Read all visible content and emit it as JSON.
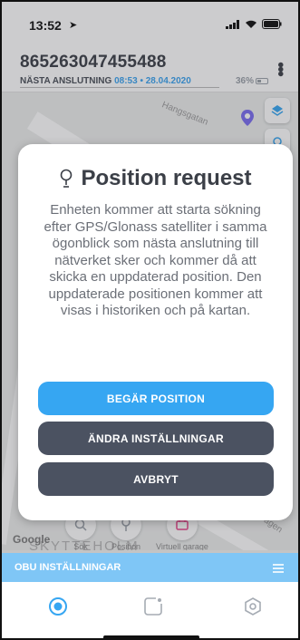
{
  "status_bar": {
    "time": "13:52"
  },
  "header": {
    "device_id": "865263047455488",
    "connection_label": "NÄSTA ANSLUTNING",
    "connection_time": "08:53",
    "separator": "•",
    "connection_date": "28.04.2020",
    "battery_level": "36%"
  },
  "map": {
    "street_1": "Hangsgatan",
    "street_2": "Vägen",
    "district": "SKYTTEHOLM",
    "attribution": "Google",
    "toolbar": [
      {
        "label": "Sök",
        "icon": "search-icon"
      },
      {
        "label": "Position",
        "icon": "pin-icon"
      },
      {
        "label": "Virtuell garage",
        "icon": "garage-icon"
      }
    ]
  },
  "modal": {
    "title": "Position request",
    "body": "Enheten kommer att starta sökning efter GPS/Glonass satelliter i samma ögonblick som nästa anslutning till nätverket sker och kommer då att skicka en uppdaterad position. Den uppdaterade positionen kommer att visas i historiken och på kartan.",
    "primary_button": "BEGÄR POSITION",
    "settings_button": "ÄNDRA INSTÄLLNINGAR",
    "cancel_button": "AVBRYT"
  },
  "obu_bar": {
    "label": "OBU INSTÄLLNINGAR"
  },
  "tabs": [
    {
      "icon": "radar-icon",
      "active": true
    },
    {
      "icon": "device-icon",
      "active": false
    },
    {
      "icon": "settings-icon",
      "active": false
    }
  ],
  "colors": {
    "accent": "#36a6f2",
    "dark_button": "#4b5261",
    "title_text": "#3b3f47",
    "obu_bar": "#7fc6f6"
  }
}
